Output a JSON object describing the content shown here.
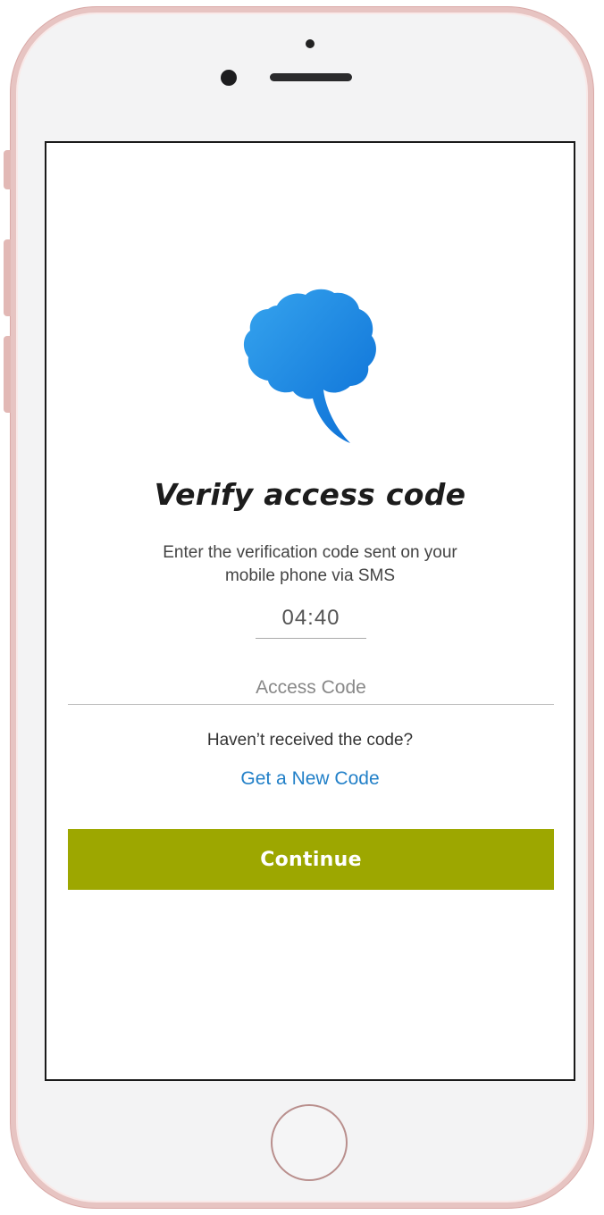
{
  "screen": {
    "title": "Verify access code",
    "instructions_line1": "Enter the verification code sent on your",
    "instructions_line2": "mobile phone via  SMS",
    "timer": "04:40",
    "access_code": {
      "value": "",
      "placeholder": "Access Code"
    },
    "not_received_text": "Haven’t received the code?",
    "new_code_link": "Get a New Code",
    "continue_label": "Continue"
  },
  "colors": {
    "accent_button": "#9da700",
    "link": "#2280c8",
    "logo_light": "#36a4ee",
    "logo_dark": "#0b6fd6"
  },
  "icons": {
    "logo": "brain-speech-bubble-icon"
  }
}
